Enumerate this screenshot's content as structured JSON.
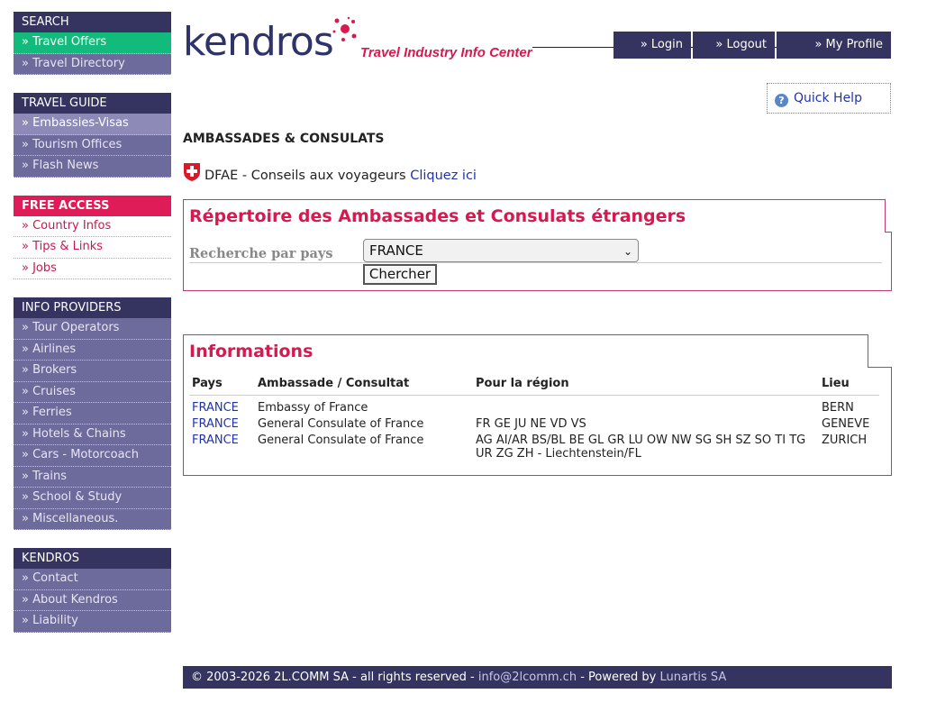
{
  "sidebar": {
    "search": {
      "heading": "SEARCH",
      "items": [
        "» Travel Offers",
        "» Travel Directory"
      ]
    },
    "travel_guide": {
      "heading": "TRAVEL GUIDE",
      "items": [
        "» Embassies-Visas",
        "» Tourism Offices",
        "» Flash News"
      ]
    },
    "free_access": {
      "heading": "FREE ACCESS",
      "items": [
        "» Country Infos",
        "» Tips & Links",
        "» Jobs"
      ]
    },
    "info_providers": {
      "heading": "INFO PROVIDERS",
      "items": [
        "» Tour Operators",
        "» Airlines",
        "» Brokers",
        "» Cruises",
        "» Ferries",
        "» Hotels & Chains",
        "» Cars - Motorcoach",
        "» Trains",
        "» School & Study",
        "» Miscellaneous."
      ]
    },
    "kendros": {
      "heading": "KENDROS",
      "items": [
        "» Contact",
        "» About Kendros",
        "» Liability"
      ]
    }
  },
  "header": {
    "logo_word": "kendros",
    "tagline": "Travel Industry Info Center",
    "nav": {
      "login": "» Login",
      "logout": "» Logout",
      "profile": "» My Profile"
    },
    "quick_help": "Quick Help"
  },
  "main": {
    "page_title": "AMBASSADES & CONSULATS",
    "dfae_text": "DFAE - Conseils aux voyageurs",
    "dfae_link": "Cliquez ici",
    "search": {
      "title": "Répertoire des Ambassades et Consulats étrangers",
      "label": "Recherche par pays",
      "selected_country": "FRANCE",
      "button": "Chercher"
    },
    "info": {
      "title": "Informations",
      "columns": [
        "Pays",
        "Ambassade / Consultat",
        "Pour la région",
        "Lieu"
      ],
      "rows": [
        [
          "FRANCE",
          "Embassy of France",
          "",
          "BERN"
        ],
        [
          "FRANCE",
          "General Consulate of France",
          "FR GE JU NE VD VS",
          "GENEVE"
        ],
        [
          "FRANCE",
          "General Consulate of France",
          "AG AI/AR BS/BL BE GL GR LU OW NW SG SH SZ SO TI TG UR ZG ZH - Liechtenstein/FL",
          "ZURICH"
        ]
      ]
    }
  },
  "footer": {
    "copyright": "© 2003-2026 2L.COMM SA - all rights reserved - ",
    "email": "info@2lcomm.ch",
    "powered": " - Powered by ",
    "powered_by": "Lunartis SA"
  },
  "colors": {
    "nav_dark": "#35335f",
    "item_purple": "#6d6a9c",
    "accent_pink": "#d8194f",
    "active_green": "#12bb7c",
    "link_blue": "#2233aa"
  }
}
